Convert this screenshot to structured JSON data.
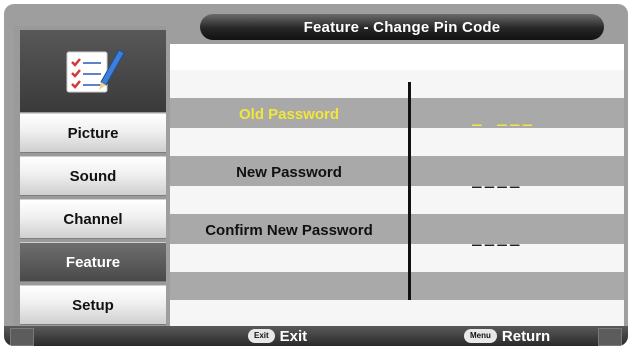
{
  "header": {
    "title": "Feature - Change Pin Code"
  },
  "sidebar": {
    "logo_icon": "checklist-pencil-icon",
    "items": [
      {
        "label": "Picture",
        "active": false
      },
      {
        "label": "Sound",
        "active": false
      },
      {
        "label": "Channel",
        "active": false
      },
      {
        "label": "Feature",
        "active": true
      },
      {
        "label": "Setup",
        "active": false
      }
    ]
  },
  "form": {
    "rows": [
      {
        "label": "Old Password",
        "value": "_ ___",
        "focused": true
      },
      {
        "label": "New Password",
        "value": "____",
        "focused": false
      },
      {
        "label": "Confirm New Password",
        "value": "____",
        "focused": false
      }
    ]
  },
  "footer": {
    "exit": {
      "key": "Exit",
      "label": "Exit"
    },
    "return": {
      "key": "Menu",
      "label": "Return"
    }
  },
  "colors": {
    "highlight_text": "#f2e63a",
    "active_item_bg": "#4a4a4a",
    "stripe_gray": "#a8a8a8"
  }
}
